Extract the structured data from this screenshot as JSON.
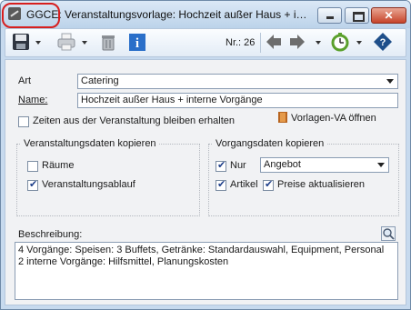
{
  "window": {
    "title": "GGCE: Veranstaltungsvorlage: Hochzeit außer Haus + interne Vorgänge",
    "close_glyph": "✕"
  },
  "toolbar": {
    "nr_label": "Nr.: 26",
    "icons": [
      "save-icon",
      "print-icon",
      "delete-icon",
      "info-icon",
      "back-arrow-icon",
      "forward-arrow-icon",
      "stopwatch-icon",
      "help-icon"
    ]
  },
  "form": {
    "art_label": "Art",
    "art_value": "Catering",
    "name_label": "Name:",
    "name_value": "Hochzeit außer Haus + interne Vorgänge",
    "keep_times_label": "Zeiten aus der Veranstaltung bleiben erhalten",
    "keep_times_checked": false,
    "open_template_label": "Vorlagen-VA öffnen"
  },
  "veranstaltung_group": {
    "title": "Veranstaltungsdaten kopieren",
    "raeume_label": "Räume",
    "raeume_checked": false,
    "ablauf_label": "Veranstaltungsablauf",
    "ablauf_checked": true
  },
  "vorgang_group": {
    "title": "Vorgangsdaten kopieren",
    "nur_label": "Nur",
    "nur_checked": true,
    "nur_value": "Angebot",
    "artikel_label": "Artikel",
    "artikel_checked": true,
    "preise_label": "Preise aktualisieren",
    "preise_checked": true
  },
  "beschreibung": {
    "label": "Beschreibung:",
    "lines": [
      "4 Vorgänge: Speisen: 3 Buffets, Getränke: Standardauswahl, Equipment, Personal",
      "2 interne Vorgänge: Hilfsmittel, Planungskosten"
    ]
  },
  "colors": {
    "titlebar": "#c7daee",
    "highlight": "#d71e1e",
    "info_blue": "#2a6fc9",
    "arrow_gray": "#6d6d6d",
    "clock_green": "#5aa02c",
    "help_blue": "#1f4f8a"
  }
}
